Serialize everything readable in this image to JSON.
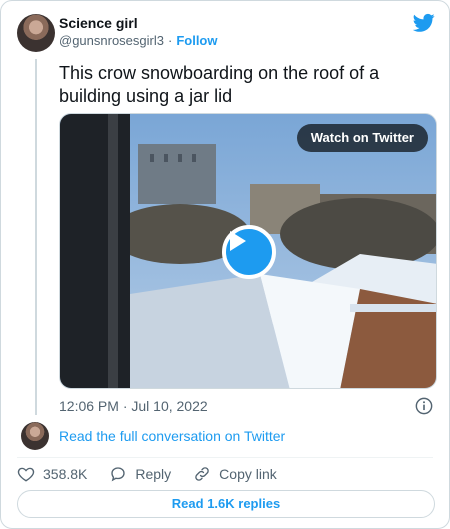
{
  "author": {
    "name": "Science girl",
    "handle": "@gunsnrosesgirl3",
    "separator": "·",
    "follow_label": "Follow"
  },
  "tweet": {
    "text": "This crow snowboarding on the roof of a building using a jar lid",
    "timestamp": "12:06 PM · Jul 10, 2022"
  },
  "media": {
    "watch_label": "Watch on Twitter"
  },
  "conversation_link": "Read the full conversation on Twitter",
  "actions": {
    "likes": "358.8K",
    "reply_label": "Reply",
    "copy_link_label": "Copy link"
  },
  "replies_button": "Read 1.6K replies",
  "colors": {
    "accent": "#1d9bf0",
    "text": "#0f1419",
    "muted": "#536471"
  },
  "icons": [
    "twitter-bird-icon",
    "play-icon",
    "info-icon",
    "heart-icon",
    "reply-bubble-icon",
    "link-icon"
  ]
}
